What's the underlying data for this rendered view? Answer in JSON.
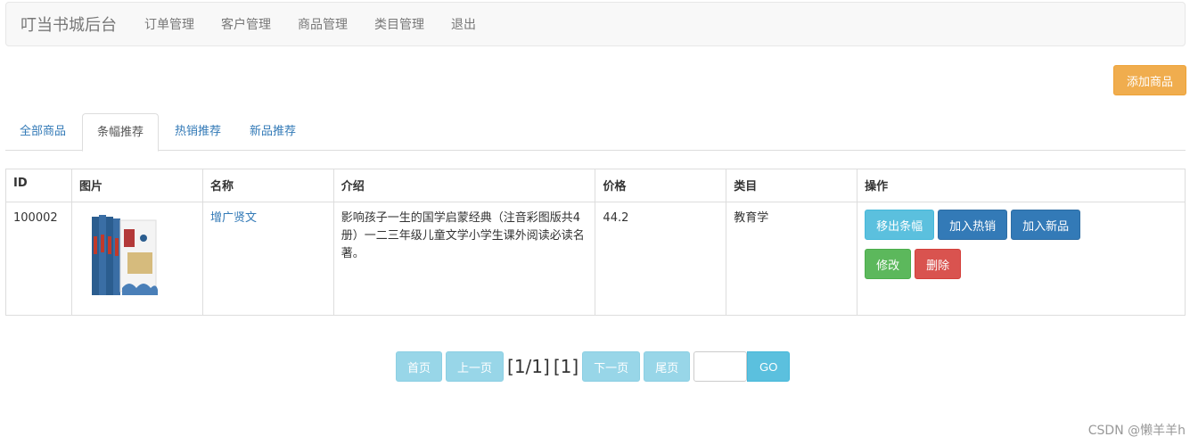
{
  "navbar": {
    "brand": "叮当书城后台",
    "items": [
      "订单管理",
      "客户管理",
      "商品管理",
      "类目管理",
      "退出"
    ]
  },
  "actions": {
    "add_label": "添加商品"
  },
  "tabs": [
    {
      "label": "全部商品",
      "active": false
    },
    {
      "label": "条幅推荐",
      "active": true
    },
    {
      "label": "热销推荐",
      "active": false
    },
    {
      "label": "新品推荐",
      "active": false
    }
  ],
  "table": {
    "headers": [
      "ID",
      "图片",
      "名称",
      "介绍",
      "价格",
      "类目",
      "操作"
    ],
    "rows": [
      {
        "id": "100002",
        "cover_icon": "book-cover-image",
        "name": "增广贤文",
        "intro": "影响孩子一生的国学启蒙经典（注音彩图版共4册）一二三年级儿童文学小学生课外阅读必读名著。",
        "price": "44.2",
        "category": "教育学",
        "ops": {
          "remove_banner": "移出条幅",
          "add_hot": "加入热销",
          "add_new": "加入新品",
          "edit": "修改",
          "delete": "删除"
        }
      }
    ]
  },
  "pager": {
    "first": "首页",
    "prev": "上一页",
    "page_info": "[1/1]",
    "current": "[1]",
    "next": "下一页",
    "last": "尾页",
    "input_value": "",
    "go": "GO"
  },
  "watermark": "CSDN @懒羊羊h",
  "colors": {
    "warning": "#f0ad4e",
    "info": "#5bc0de",
    "primary": "#337ab7",
    "success": "#5cb85c",
    "danger": "#d9534f"
  }
}
